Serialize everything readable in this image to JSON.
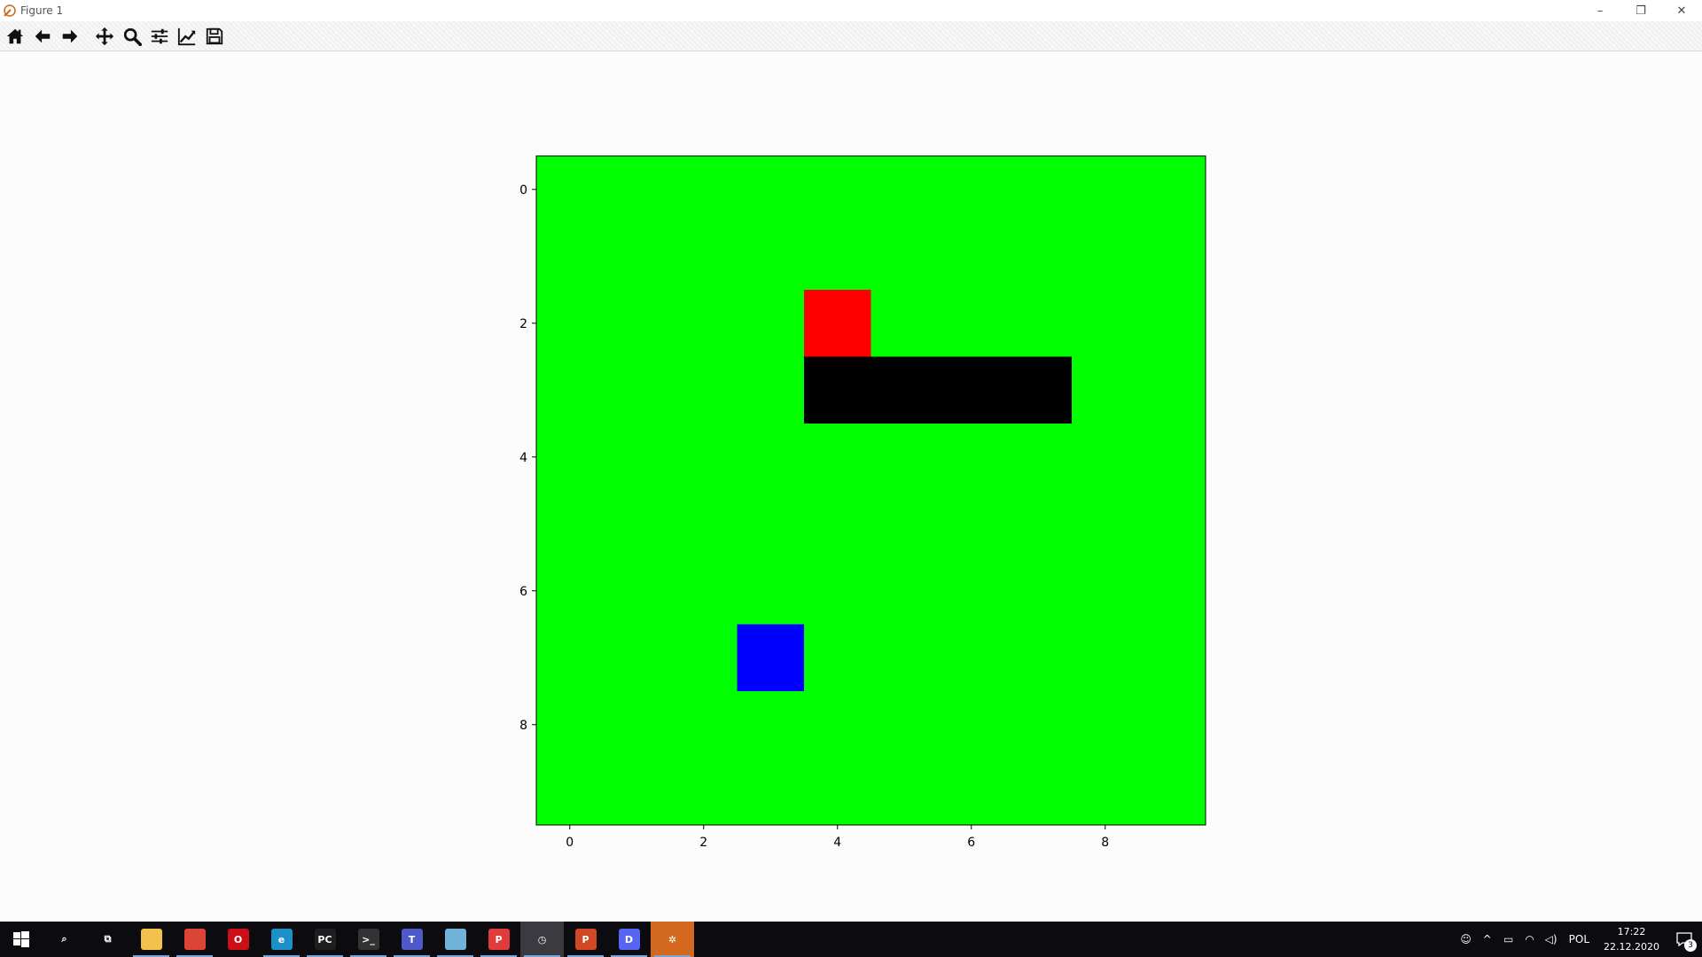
{
  "window": {
    "title": "Figure 1",
    "controls": {
      "minimize": "–",
      "restore": "❐",
      "close": "✕"
    }
  },
  "toolbar": {
    "buttons": [
      {
        "name": "home-button",
        "icon": "home-icon"
      },
      {
        "name": "back-button",
        "icon": "arrow-left-icon"
      },
      {
        "name": "forward-button",
        "icon": "arrow-right-icon"
      },
      {
        "name": "pan-button",
        "icon": "move-icon"
      },
      {
        "name": "zoom-button",
        "icon": "zoom-icon"
      },
      {
        "name": "configure-subplots-button",
        "icon": "sliders-icon"
      },
      {
        "name": "edit-axis-button",
        "icon": "line-chart-icon"
      },
      {
        "name": "save-button",
        "icon": "floppy-disk-icon"
      }
    ]
  },
  "chart_data": {
    "type": "heatmap",
    "title": "",
    "xlabel": "",
    "ylabel": "",
    "xlim": [
      -0.5,
      9.5
    ],
    "ylim": [
      9.5,
      -0.5
    ],
    "grid": false,
    "xticks": [
      0,
      2,
      4,
      6,
      8
    ],
    "yticks": [
      0,
      2,
      4,
      6,
      8
    ],
    "xtick_labels": [
      "0",
      "2",
      "4",
      "6",
      "8"
    ],
    "ytick_labels": [
      "0",
      "2",
      "4",
      "6",
      "8"
    ],
    "background_color": "#00ff00",
    "cells": [
      {
        "row": 2,
        "col": 4,
        "color": "#ff0000"
      },
      {
        "row": 3,
        "col": 4,
        "color": "#000000"
      },
      {
        "row": 3,
        "col": 5,
        "color": "#000000"
      },
      {
        "row": 3,
        "col": 6,
        "color": "#000000"
      },
      {
        "row": 3,
        "col": 7,
        "color": "#000000"
      },
      {
        "row": 7,
        "col": 3,
        "color": "#0000ff"
      }
    ]
  },
  "taskbar": {
    "apps": [
      {
        "name": "search-icon",
        "label": "⌕",
        "color": "#0b0b10",
        "running": false
      },
      {
        "name": "task-view-icon",
        "label": "⧉",
        "color": "#0b0b10",
        "running": false
      },
      {
        "name": "file-explorer-icon",
        "label": "",
        "color": "#f2c14e",
        "running": true
      },
      {
        "name": "chrome-icon",
        "label": "",
        "color": "#db4437",
        "running": true
      },
      {
        "name": "opera-icon",
        "label": "O",
        "color": "#cc0f16",
        "running": false
      },
      {
        "name": "edge-icon",
        "label": "e",
        "color": "#1e90c8",
        "running": true
      },
      {
        "name": "pycharm-icon",
        "label": "PC",
        "color": "#1f1f1f",
        "running": true
      },
      {
        "name": "terminal-icon",
        "label": ">_",
        "color": "#333333",
        "running": true
      },
      {
        "name": "teams-icon",
        "label": "T",
        "color": "#5059c9",
        "running": true
      },
      {
        "name": "notes-icon",
        "label": "",
        "color": "#6fb3d9",
        "running": true
      },
      {
        "name": "remote-app-icon",
        "label": "P",
        "color": "#e23b3b",
        "running": true
      },
      {
        "name": "clock-app-icon",
        "label": "◷",
        "color": "#3a3a40",
        "running": true
      },
      {
        "name": "powerpoint-icon",
        "label": "P",
        "color": "#d24726",
        "running": true
      },
      {
        "name": "discord-icon",
        "label": "D",
        "color": "#5865f2",
        "running": true
      },
      {
        "name": "matplotlib-figure-icon",
        "label": "✲",
        "color": "#d2691e",
        "running": true
      }
    ],
    "tray": {
      "people": "☺",
      "chevron": "^",
      "battery": "▭",
      "wifi": "◠",
      "volume": "◁)",
      "language": "POL",
      "time": "17:22",
      "date": "22.12.2020",
      "notifications": "3"
    }
  }
}
